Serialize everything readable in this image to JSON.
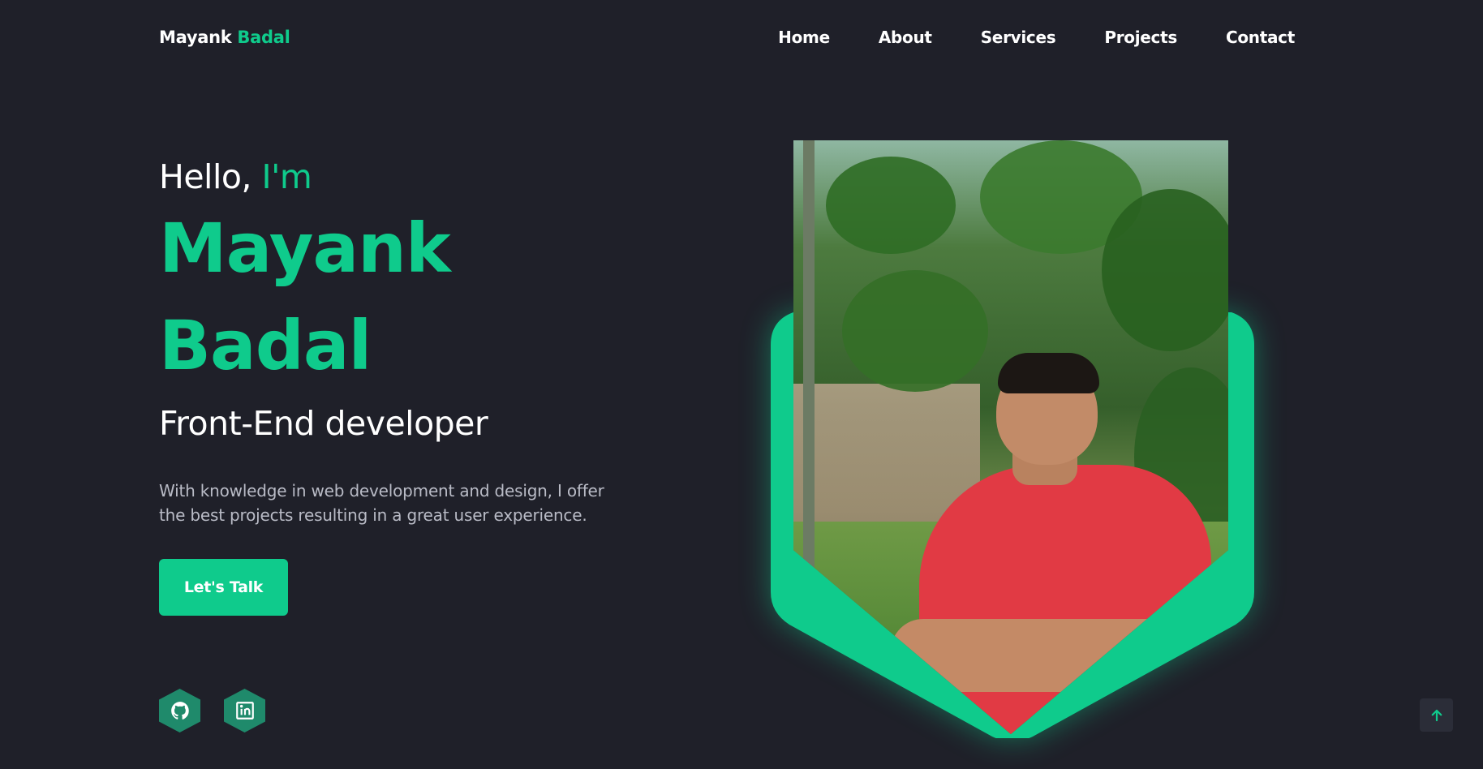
{
  "nav": {
    "logo_first": "Mayank",
    "logo_accent": "Badal",
    "links": [
      "Home",
      "About",
      "Services",
      "Projects",
      "Contact"
    ]
  },
  "hero": {
    "greeting": "Hello,",
    "greeting_accent": "I'm",
    "name_first": "Mayank",
    "name_last": "Badal",
    "role": "Front-End developer",
    "description": "With knowledge in web development and design, I offer the best projects resulting in a great user experience.",
    "cta_label": "Let's Talk"
  },
  "socials": [
    {
      "icon": "github-icon"
    },
    {
      "icon": "linkedin-icon"
    }
  ],
  "scroll_top": {
    "icon": "arrow-up-icon"
  },
  "colors": {
    "background": "#1f2029",
    "accent": "#0fcb8c",
    "muted_text": "#b9bbc6",
    "social_bg": "#1f8a6b"
  }
}
